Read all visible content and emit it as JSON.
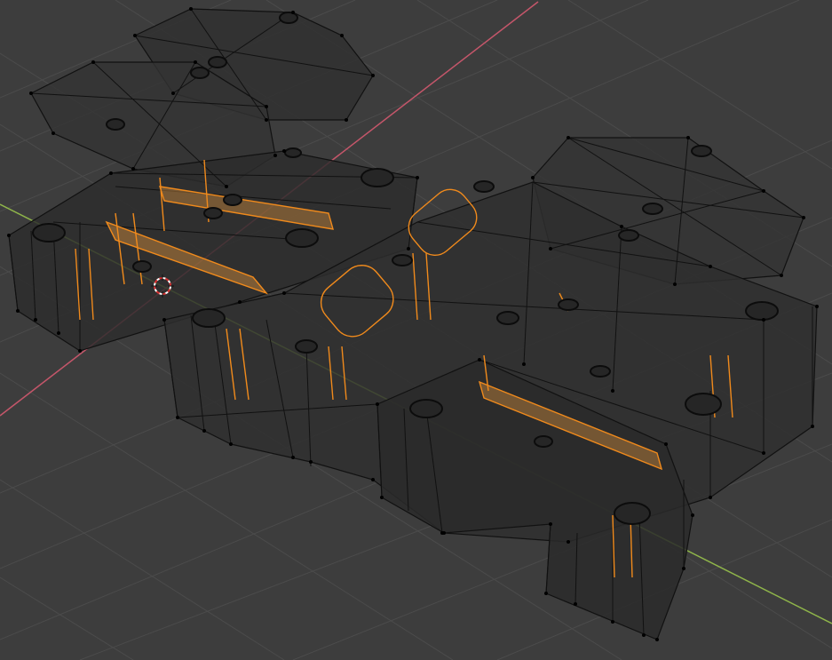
{
  "viewport": {
    "background_color": "#3d3d3d",
    "grid_color": "#4a4a4a",
    "x_axis_color": "#c4566a",
    "y_axis_color": "#8fb54a",
    "wire_color": "#0c0c0c",
    "selected_color": "#f08a1c",
    "fill_color": "#2e2e2e"
  },
  "icons": {
    "cursor": "3d-cursor-icon"
  }
}
